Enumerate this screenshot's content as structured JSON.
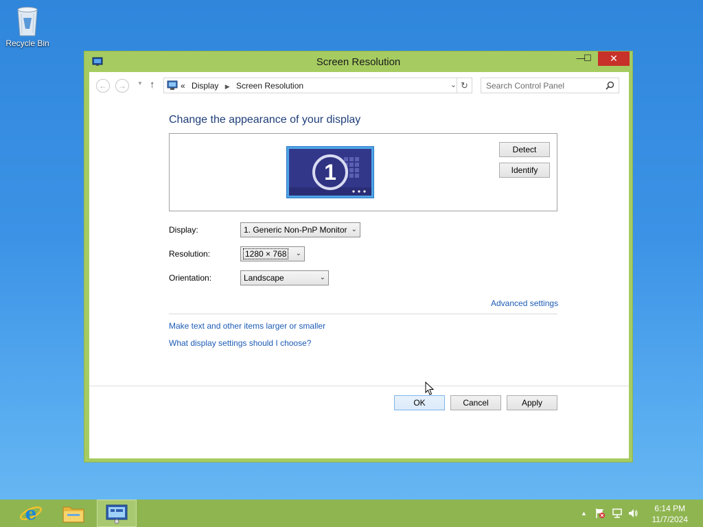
{
  "desktop": {
    "recycle_bin_label": "Recycle Bin"
  },
  "window": {
    "title": "Screen Resolution",
    "close_glyph": "✕",
    "minimize_glyph": "—",
    "maximize_glyph": "☐"
  },
  "address_bar": {
    "prefix": "«",
    "breadcrumb": [
      "Display",
      "Screen Resolution"
    ],
    "search_placeholder": "Search Control Panel"
  },
  "content": {
    "heading": "Change the appearance of your display",
    "monitor_number": "1",
    "detect_label": "Detect",
    "identify_label": "Identify",
    "display_label": "Display:",
    "display_value": "1. Generic Non-PnP Monitor",
    "resolution_label": "Resolution:",
    "resolution_value": "1280 × 768",
    "orientation_label": "Orientation:",
    "orientation_value": "Landscape",
    "advanced_link": "Advanced settings",
    "link_text_size": "Make text and other items larger or smaller",
    "link_display_help": "What display settings should I choose?"
  },
  "buttons": {
    "ok": "OK",
    "cancel": "Cancel",
    "apply": "Apply"
  },
  "taskbar": {
    "time": "6:14 PM",
    "date": "11/7/2024",
    "tray_chevron": "▲"
  },
  "colors": {
    "window_frame": "#a6cc61",
    "close_button": "#c7312a",
    "link": "#1c5bb5",
    "heading": "#1e3d78",
    "taskbar": "#8fb551"
  }
}
